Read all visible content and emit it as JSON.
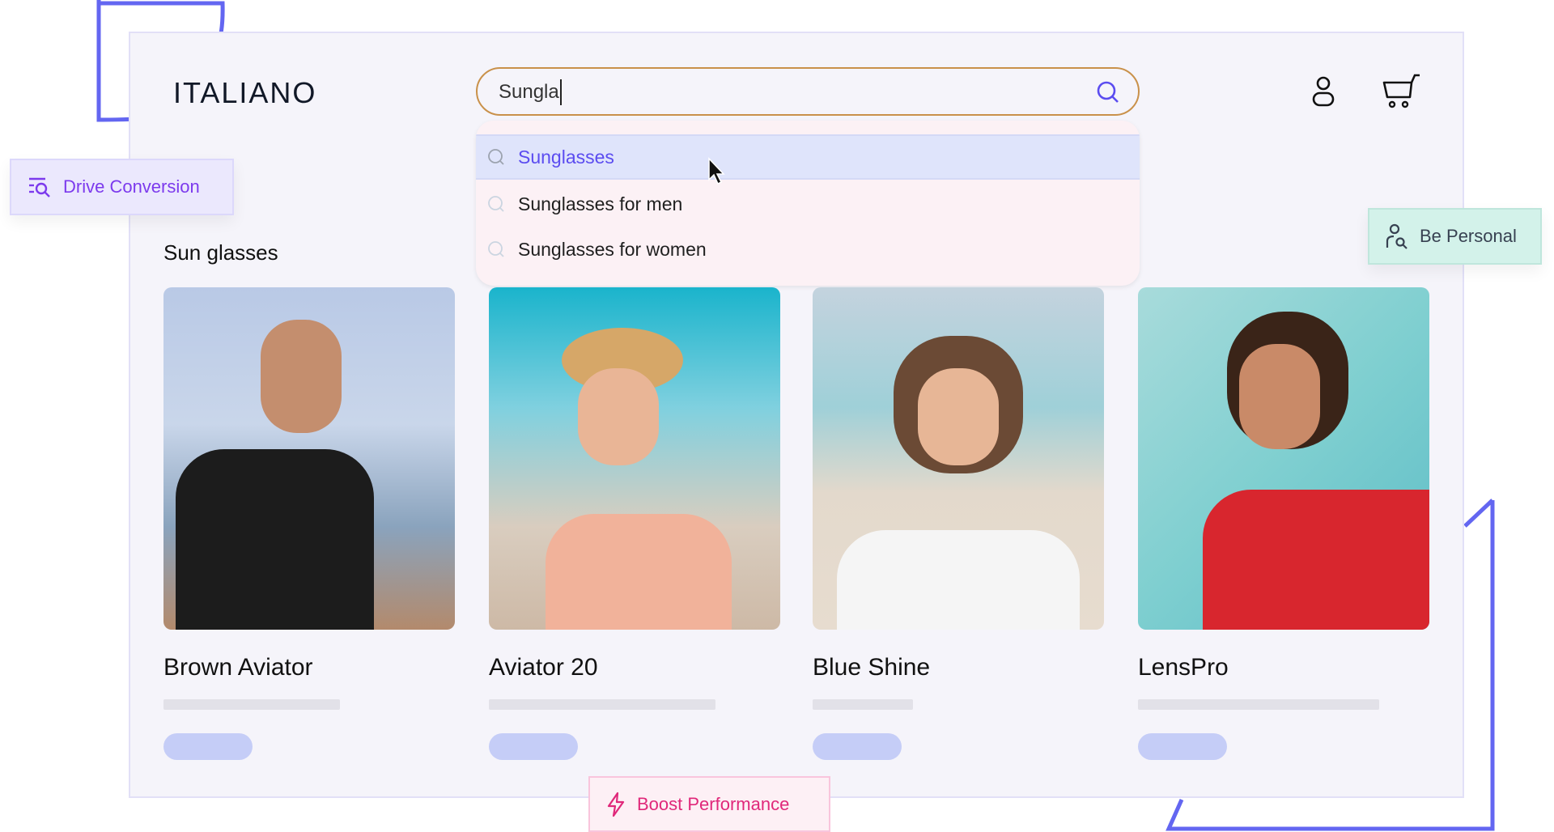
{
  "header": {
    "logo": "ITALIANO",
    "search_value": "Sungla",
    "user_icon": "user-icon",
    "cart_icon": "cart-icon"
  },
  "suggestions": [
    {
      "label": "Sunglasses",
      "highlighted": true
    },
    {
      "label": "Sunglasses for men",
      "highlighted": false
    },
    {
      "label": "Sunglasses for women",
      "highlighted": false
    }
  ],
  "badges": {
    "drive": "Drive Conversion",
    "personal": "Be Personal",
    "boost": "Boost Performance"
  },
  "section_title": "Sun glasses",
  "products": [
    {
      "name": "Brown Aviator"
    },
    {
      "name": "Aviator 20"
    },
    {
      "name": "Blue Shine"
    },
    {
      "name": "LensPro"
    }
  ],
  "colors": {
    "accent": "#5b4cf0",
    "search_border": "#c9914a",
    "drive": "#7c3aed",
    "boost": "#e0287a",
    "personal_bg": "#d3f2ea"
  }
}
